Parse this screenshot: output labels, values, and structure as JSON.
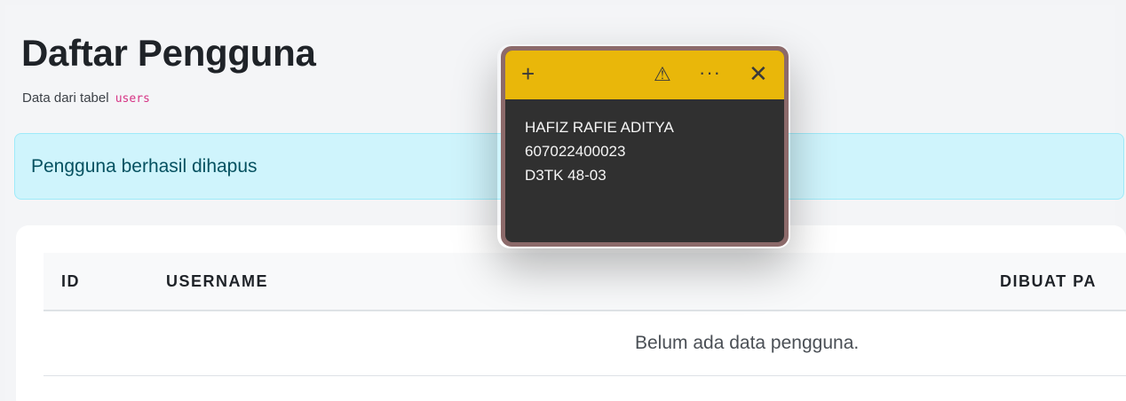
{
  "page": {
    "title": "Daftar Pengguna",
    "subtitle_prefix": "Data dari tabel",
    "subtitle_code": "users"
  },
  "alert": {
    "message": "Pengguna berhasil dihapus",
    "color": "#cff4fc"
  },
  "table": {
    "columns": [
      "ID",
      "USERNAME",
      "DIBUAT PA"
    ],
    "empty_message": "Belum ada data pengguna."
  },
  "sticky_note": {
    "color": "#e9b70a",
    "toolbar": {
      "add_icon": "+",
      "warning_icon": "⚠",
      "more_icon": "···",
      "close_icon": "✕"
    },
    "lines": [
      "HAFIZ RAFIE ADITYA",
      "607022400023",
      "D3TK 48-03"
    ]
  }
}
